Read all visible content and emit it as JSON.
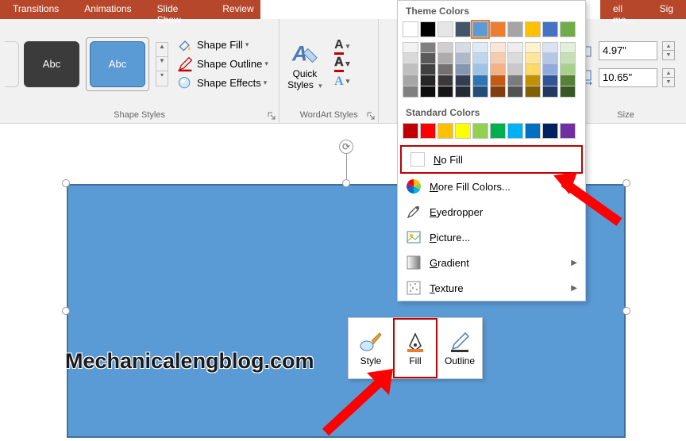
{
  "tabs": {
    "transitions": "Transitions",
    "animations": "Animations",
    "slideshow": "Slide Show",
    "review": "Review",
    "tellme": "ell me...",
    "sign": "Sig"
  },
  "ribbon": {
    "shape_styles_label": "Shape Styles",
    "wordart_label": "WordArt Styles",
    "size_label": "Size",
    "abc": "Abc",
    "shape_fill": "Shape Fill",
    "shape_outline": "Shape Outline",
    "shape_effects": "Shape Effects",
    "quick_styles_l1": "Quick",
    "quick_styles_l2": "Styles",
    "height_value": "4.97\"",
    "width_value": "10.65\""
  },
  "color_panel": {
    "theme_title": "Theme Colors",
    "standard_title": "Standard Colors",
    "no_fill": "No Fill",
    "more_colors": "More Fill Colors...",
    "eyedropper": "Eyedropper",
    "picture": "Picture...",
    "gradient": "Gradient",
    "texture": "Texture",
    "theme_row": [
      "#ffffff",
      "#000000",
      "#e7e6e6",
      "#44546a",
      "#5b9bd5",
      "#ed7d31",
      "#a5a5a5",
      "#ffc000",
      "#4472c4",
      "#70ad47"
    ],
    "theme_shades": [
      [
        "#f2f2f2",
        "#d9d9d9",
        "#bfbfbf",
        "#a6a6a6",
        "#808080"
      ],
      [
        "#808080",
        "#595959",
        "#404040",
        "#262626",
        "#0d0d0d"
      ],
      [
        "#d0cece",
        "#aeabab",
        "#757070",
        "#3a3838",
        "#171616"
      ],
      [
        "#d6dce5",
        "#adb9ca",
        "#8497b0",
        "#333f50",
        "#222a35"
      ],
      [
        "#deebf7",
        "#bdd7ee",
        "#9dc3e6",
        "#2e75b6",
        "#1f4e79"
      ],
      [
        "#fbe5d6",
        "#f8cbad",
        "#f4b183",
        "#c55a11",
        "#843c0c"
      ],
      [
        "#ededed",
        "#dbdbdb",
        "#c9c9c9",
        "#7b7b7b",
        "#525252"
      ],
      [
        "#fff2cc",
        "#ffe699",
        "#ffd966",
        "#bf9000",
        "#806000"
      ],
      [
        "#dae3f3",
        "#b4c7e7",
        "#8faadc",
        "#2f5597",
        "#203864"
      ],
      [
        "#e2f0d9",
        "#c5e0b4",
        "#a9d18e",
        "#548235",
        "#385723"
      ]
    ],
    "standard_row": [
      "#c00000",
      "#ff0000",
      "#ffc000",
      "#ffff00",
      "#92d050",
      "#00b050",
      "#00b0f0",
      "#0070c0",
      "#002060",
      "#7030a0"
    ]
  },
  "mini_toolbar": {
    "style": "Style",
    "fill": "Fill",
    "outline": "Outline"
  },
  "watermark": "Mechanicalengblog.com"
}
